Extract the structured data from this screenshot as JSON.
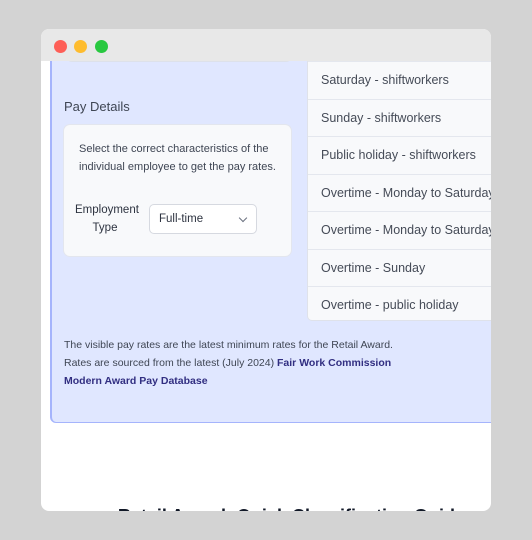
{
  "window": {
    "controls": [
      "close",
      "minimize",
      "maximize"
    ]
  },
  "pay_details": {
    "section_title": "Pay Details",
    "description": "Select the correct characteristics of the individual employee to get the pay rates.",
    "employment_type": {
      "label_line1": "Employment",
      "label_line2": "Type",
      "selected": "Full-time"
    }
  },
  "rates": [
    "Saturday - shiftworkers",
    "Sunday - shiftworkers",
    "Public holiday - shiftworkers",
    "Overtime - Monday to Saturday",
    "Overtime - Monday to Saturday",
    "Overtime - Sunday",
    "Overtime - public holiday"
  ],
  "footnote": {
    "line1": "The visible pay rates are the latest minimum rates for the Retail Award.",
    "line2_prefix": "Rates are sourced from the latest (July 2024) ",
    "link_text": "Fair Work Commission Modern Award Pay Database"
  },
  "page_title": "Retail Award: Quick Classification Guide",
  "colors": {
    "panel_bg": "#e0e7ff",
    "panel_border": "#a5b4fc",
    "link": "#312e81"
  }
}
